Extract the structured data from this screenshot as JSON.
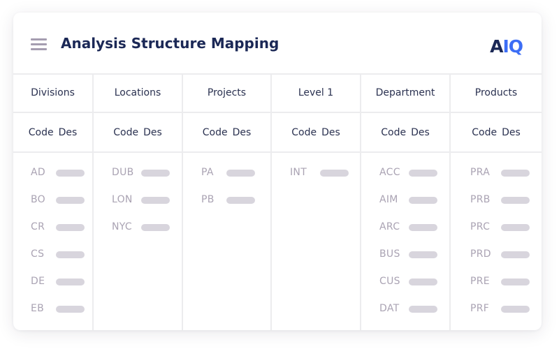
{
  "header": {
    "title": "Analysis Structure Mapping",
    "logo_part1": "A",
    "logo_part2": "IQ",
    "menu_icon": "hamburger-menu-icon"
  },
  "colors": {
    "title": "#1b2856",
    "logo_accent": "#3d6ef5",
    "code_text": "#aaa3b3",
    "placeholder_pill": "#d8d5dd",
    "divider": "#ececee"
  },
  "columns": [
    {
      "title": "Divisions",
      "sub_code": "Code",
      "sub_des": "Des",
      "codes": [
        "AD",
        "BO",
        "CR",
        "CS",
        "DE",
        "EB"
      ]
    },
    {
      "title": "Locations",
      "sub_code": "Code",
      "sub_des": "Des",
      "codes": [
        "DUB",
        "LON",
        "NYC"
      ]
    },
    {
      "title": "Projects",
      "sub_code": "Code",
      "sub_des": "Des",
      "codes": [
        "PA",
        "PB"
      ]
    },
    {
      "title": "Level 1",
      "sub_code": "Code",
      "sub_des": "Des",
      "codes": [
        "INT"
      ]
    },
    {
      "title": "Department",
      "sub_code": "Code",
      "sub_des": "Des",
      "codes": [
        "ACC",
        "AIM",
        "ARC",
        "BUS",
        "CUS",
        "DAT"
      ]
    },
    {
      "title": "Products",
      "sub_code": "Code",
      "sub_des": "Des",
      "codes": [
        "PRA",
        "PRB",
        "PRC",
        "PRD",
        "PRE",
        "PRF"
      ]
    }
  ]
}
